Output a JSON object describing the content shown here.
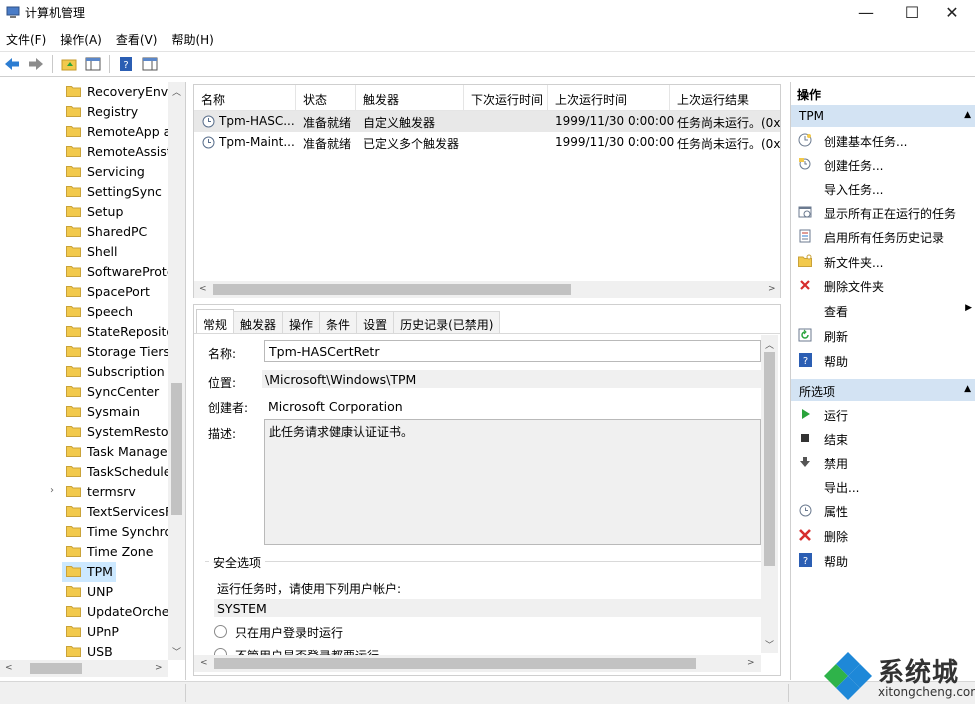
{
  "window": {
    "title": "计算机管理",
    "controls": {
      "minimize": "—",
      "maximize": "☐",
      "close": "✕"
    }
  },
  "menubar": [
    {
      "label": "文件(F)"
    },
    {
      "label": "操作(A)"
    },
    {
      "label": "查看(V)"
    },
    {
      "label": "帮助(H)"
    }
  ],
  "toolbar": [
    {
      "icon": "back-arrow-icon"
    },
    {
      "icon": "forward-arrow-icon"
    },
    {
      "icon": "up-folder-icon"
    },
    {
      "icon": "show-hide-tree-icon"
    },
    {
      "icon": "help-icon"
    },
    {
      "icon": "show-hide-action-pane-icon"
    }
  ],
  "tree": {
    "selected": "TPM",
    "items": [
      {
        "label": "RecoveryEnvir"
      },
      {
        "label": "Registry"
      },
      {
        "label": "RemoteApp a"
      },
      {
        "label": "RemoteAssista"
      },
      {
        "label": "Servicing"
      },
      {
        "label": "SettingSync"
      },
      {
        "label": "Setup"
      },
      {
        "label": "SharedPC"
      },
      {
        "label": "Shell"
      },
      {
        "label": "SoftwareProte"
      },
      {
        "label": "SpacePort"
      },
      {
        "label": "Speech"
      },
      {
        "label": "StateReposito"
      },
      {
        "label": "Storage Tiers"
      },
      {
        "label": "Subscription"
      },
      {
        "label": "SyncCenter"
      },
      {
        "label": "Sysmain"
      },
      {
        "label": "SystemRestor"
      },
      {
        "label": "Task Manage"
      },
      {
        "label": "TaskSchedule"
      },
      {
        "label": "termsrv",
        "expandable": true
      },
      {
        "label": "TextServicesFr"
      },
      {
        "label": "Time Synchroı"
      },
      {
        "label": "Time Zone"
      },
      {
        "label": "TPM",
        "selected": true
      },
      {
        "label": "UNP"
      },
      {
        "label": "UpdateOrches"
      },
      {
        "label": "UPnP"
      },
      {
        "label": "USB"
      }
    ]
  },
  "tasklist": {
    "columns": [
      "名称",
      "状态",
      "触发器",
      "下次运行时间",
      "上次运行时间",
      "上次运行结果"
    ],
    "rows": [
      {
        "name": "Tpm-HASC...",
        "status": "准备就绪",
        "trigger": "自定义触发器",
        "next": "",
        "last": "1999/11/30 0:00:00",
        "result": "任务尚未运行。(0x",
        "selected": true
      },
      {
        "name": "Tpm-Maint...",
        "status": "准备就绪",
        "trigger": "已定义多个触发器",
        "next": "",
        "last": "1999/11/30 0:00:00",
        "result": "任务尚未运行。(0x",
        "selected": false
      }
    ]
  },
  "details": {
    "tabs": [
      "常规",
      "触发器",
      "操作",
      "条件",
      "设置",
      "历史记录(已禁用)"
    ],
    "active_tab": "常规",
    "name_label": "名称:",
    "name_value": "Tpm-HASCertRetr",
    "location_label": "位置:",
    "location_value": "\\Microsoft\\Windows\\TPM",
    "author_label": "创建者:",
    "author_value": "Microsoft Corporation",
    "description_label": "描述:",
    "description_value": "此任务请求健康认证证书。",
    "security_title": "安全选项",
    "run_as_prompt": "运行任务时，请使用下列用户帐户:",
    "run_as_user": "SYSTEM",
    "option_logged_on": "只在用户登录时运行",
    "option_whether_logged": "不管用户是否登录都要运行"
  },
  "actions": {
    "heading": "操作",
    "section_tpm": "TPM",
    "tpm_items": [
      {
        "label": "创建基本任务...",
        "icon": "create-basic-task-icon"
      },
      {
        "label": "创建任务...",
        "icon": "create-task-icon"
      },
      {
        "label": "导入任务...",
        "icon": ""
      },
      {
        "label": "显示所有正在运行的任务",
        "icon": "running-tasks-icon"
      },
      {
        "label": "启用所有任务历史记录",
        "icon": "task-history-icon"
      },
      {
        "label": "新文件夹...",
        "icon": "new-folder-icon"
      },
      {
        "label": "删除文件夹",
        "icon": "delete-folder-icon"
      },
      {
        "label": "查看",
        "icon": "",
        "submenu": true
      },
      {
        "label": "刷新",
        "icon": "refresh-icon"
      },
      {
        "label": "帮助",
        "icon": "help-icon"
      }
    ],
    "section_selected": "所选项",
    "selected_items": [
      {
        "label": "运行",
        "icon": "run-icon"
      },
      {
        "label": "结束",
        "icon": "end-icon"
      },
      {
        "label": "禁用",
        "icon": "disable-icon"
      },
      {
        "label": "导出...",
        "icon": ""
      },
      {
        "label": "属性",
        "icon": "properties-icon"
      },
      {
        "label": "删除",
        "icon": "delete-icon"
      },
      {
        "label": "帮助",
        "icon": "help-icon"
      }
    ]
  },
  "watermark": {
    "text": "系统城",
    "url": "xitongcheng.com"
  },
  "colors": {
    "section_bg": "#d3e3f3",
    "selection_bg": "#cce8ff",
    "folder": "#f2c94c",
    "help_blue": "#2b5eb3",
    "delete_red": "#d62d2d",
    "run_green": "#2aa33b",
    "watermark_blue": "#1e88d8",
    "watermark_green": "#2fb34a"
  }
}
